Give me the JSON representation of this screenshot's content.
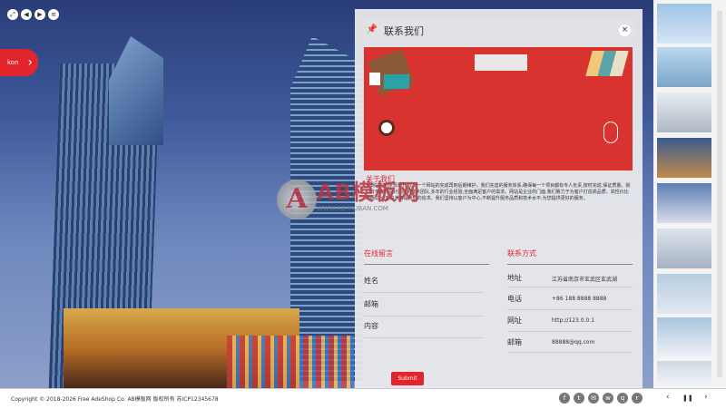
{
  "sidebar": {
    "label": "kon"
  },
  "panel": {
    "title": "联系我们",
    "close_icon": "×",
    "about": {
      "heading": "关于我们",
      "text": "从网站的初步规划开始,到一个网站的完成再到后期维护。我们完善的服务体系,确保每一个项目都有专人负责,按时完成,保证质量。我们有专业的设计团队和技术团队,多年的行业经验,全面满足客户的需求。网站是企业的门面,我们致力于为客户打造高品质、高性价比的网站,让客户满意是我们的追求。我们坚持以客户为中心,不断提升服务品质和技术水平,为您提供更好的服务。"
    },
    "form": {
      "heading": "在线留言",
      "fields": [
        "姓名",
        "邮箱",
        "内容"
      ],
      "submit": "Submit"
    },
    "contact": {
      "heading": "联系方式",
      "rows": [
        {
          "label": "地址",
          "value": "江苏省南京市玄武区玄武湖"
        },
        {
          "label": "电话",
          "value": "+86 188 8888 8888"
        },
        {
          "label": "网址",
          "value": "http://123.0.0.1"
        },
        {
          "label": "邮箱",
          "value": "88888@qq.com"
        }
      ]
    }
  },
  "watermark": {
    "brand": "AB模板网",
    "sub": "WWW.AB-MUBAN.COM"
  },
  "footer": {
    "copyright": "Copyright © 2018-2026 Free AdeShop Co. AB模板网 版权所有   苏ICP12345678",
    "social_icons": [
      "facebook-icon",
      "twitter-icon",
      "mail-icon",
      "weibo-icon",
      "qq-icon",
      "rss-icon"
    ],
    "prev": "‹",
    "pause": "❚❚",
    "next": "›"
  },
  "colors": {
    "accent": "#e2252d"
  }
}
